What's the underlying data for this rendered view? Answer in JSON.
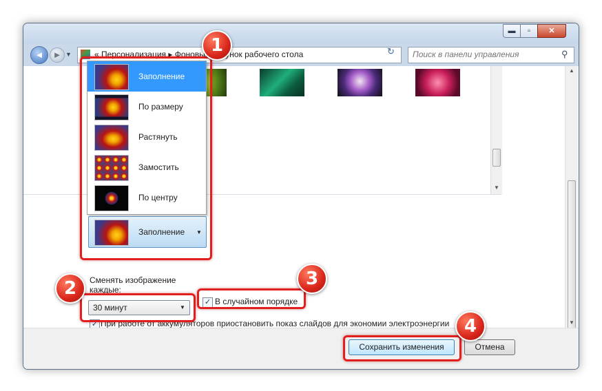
{
  "window": {
    "minimize_icon": "minimize-icon",
    "maximize_icon": "maximize-icon",
    "close_icon": "close-icon",
    "min_glyph": "▬",
    "max_glyph": "▫",
    "close_glyph": "✕"
  },
  "navigation": {
    "back_glyph": "◄",
    "forward_glyph": "►",
    "recent_glyph": "▼",
    "address_text": "« Персонализация ▸ Фоновый рисунок рабочего стола",
    "address_dropdown_glyph": "▼",
    "refresh_glyph": "↻",
    "search_placeholder": "Поиск в панели управления",
    "search_glyph": "⚲"
  },
  "position_dropdown": {
    "options": [
      {
        "label": "Заполнение",
        "selected": true
      },
      {
        "label": "По размеру",
        "selected": false
      },
      {
        "label": "Растянуть",
        "selected": false
      },
      {
        "label": "Замостить",
        "selected": false
      },
      {
        "label": "По центру",
        "selected": false
      }
    ],
    "current": "Заполнение",
    "arrow": "▼"
  },
  "slideshow": {
    "label": "Сменять изображение каждые:",
    "interval": "30 минут",
    "interval_arrow": "▼",
    "shuffle_label": "В случайном порядке",
    "shuffle_checked": true,
    "battery_label": "При работе от аккумуляторов приостановить показ слайдов для экономии электроэнергии",
    "battery_checked": true,
    "check_glyph": "✓"
  },
  "footer": {
    "save_label": "Сохранить изменения",
    "cancel_label": "Отмена"
  },
  "annotations": {
    "badges": [
      "1",
      "2",
      "3",
      "4"
    ],
    "highlight_color": "#e21e1e"
  },
  "colors": {
    "selection": "#3399ff",
    "window_frame": "#c9d9ea"
  }
}
